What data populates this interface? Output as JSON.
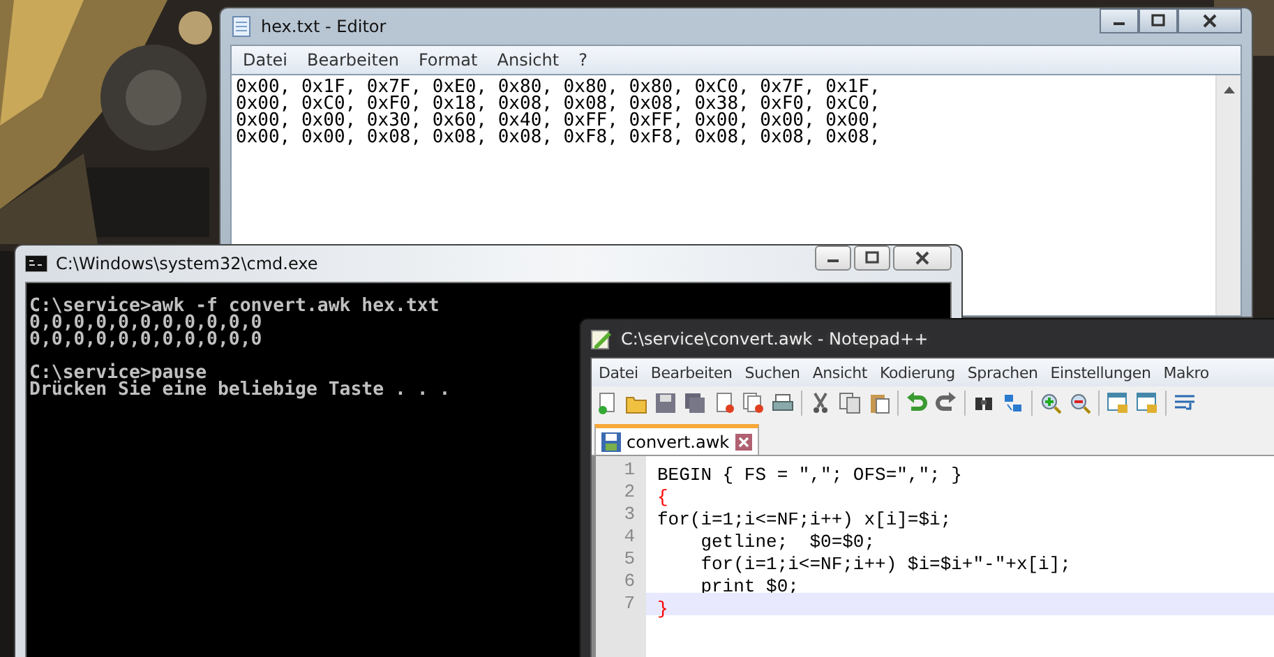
{
  "editor_window": {
    "title": "hex.txt - Editor",
    "menu": [
      "Datei",
      "Bearbeiten",
      "Format",
      "Ansicht",
      "?"
    ],
    "lines": [
      "0x00, 0x1F, 0x7F, 0xE0, 0x80, 0x80, 0x80, 0xC0, 0x7F, 0x1F,",
      "0x00, 0xC0, 0xF0, 0x18, 0x08, 0x08, 0x08, 0x38, 0xF0, 0xC0,",
      "0x00, 0x00, 0x30, 0x60, 0x40, 0xFF, 0xFF, 0x00, 0x00, 0x00,",
      "0x00, 0x00, 0x08, 0x08, 0x08, 0xF8, 0xF8, 0x08, 0x08, 0x08,"
    ]
  },
  "console_window": {
    "title": "C:\\Windows\\system32\\cmd.exe",
    "blocks": [
      {
        "lines": [
          "C:\\service>awk -f convert.awk hex.txt",
          "0,0,0,0,0,0,0,0,0,0,0",
          "0,0,0,0,0,0,0,0,0,0,0"
        ]
      },
      {
        "lines": [
          "C:\\service>pause",
          "Drücken Sie eine beliebige Taste . . ."
        ]
      }
    ]
  },
  "notepadpp_window": {
    "title": "C:\\service\\convert.awk - Notepad++",
    "menu": [
      "Datei",
      "Bearbeiten",
      "Suchen",
      "Ansicht",
      "Kodierung",
      "Sprachen",
      "Einstellungen",
      "Makro"
    ],
    "tabs": [
      {
        "label": "convert.awk",
        "selected": true
      }
    ],
    "code": [
      {
        "number": "1",
        "text": "BEGIN { FS = \",\"; OFS=\",\"; }",
        "kind": "code",
        "current": false
      },
      {
        "number": "2",
        "text": "{",
        "kind": "brace",
        "current": false
      },
      {
        "number": "3",
        "text": "for(i=1;i<=NF;i++) x[i]=$i;",
        "kind": "code",
        "current": false
      },
      {
        "number": "4",
        "text": "    getline;  $0=$0;",
        "kind": "code",
        "current": false
      },
      {
        "number": "5",
        "text": "    for(i=1;i<=NF;i++) $i=$i+\"-\"+x[i];",
        "kind": "code",
        "current": false
      },
      {
        "number": "6",
        "text": "    print $0;",
        "kind": "code",
        "current": false
      },
      {
        "number": "7",
        "text": "}",
        "kind": "brace",
        "current": true
      }
    ]
  }
}
